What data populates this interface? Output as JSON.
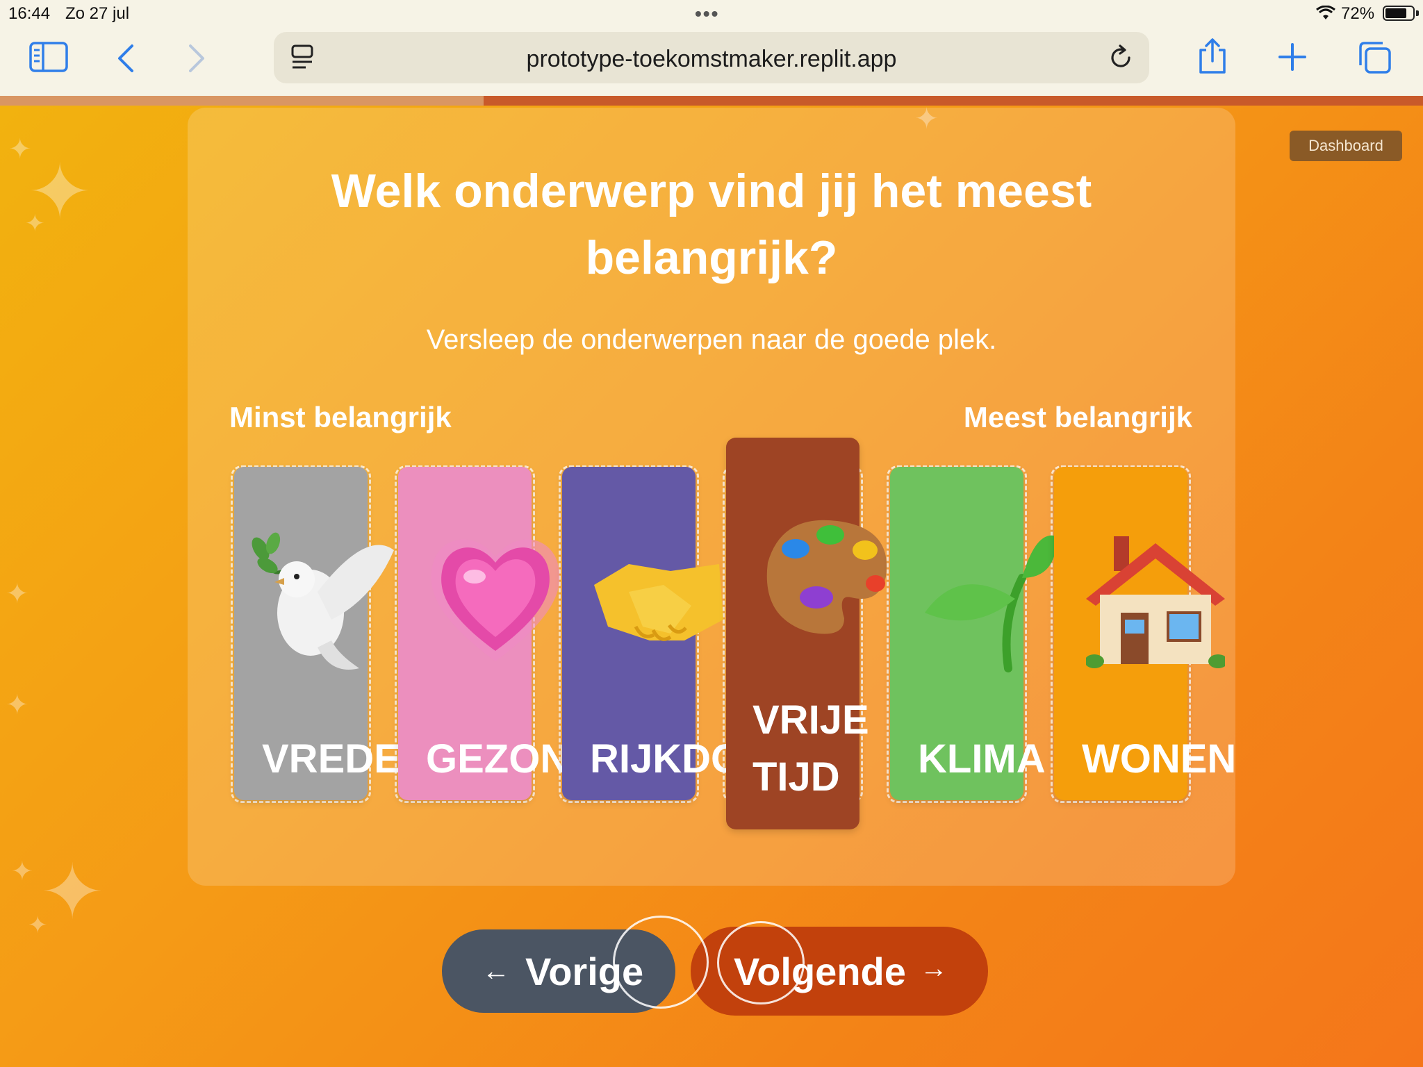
{
  "status_bar": {
    "time": "16:44",
    "date": "Zo 27 jul",
    "battery": "72%"
  },
  "browser": {
    "url": "prototype-toekomstmaker.replit.app",
    "progress": 0.34
  },
  "header": {
    "dashboard_label": "Dashboard"
  },
  "card": {
    "title": "Welk onderwerp vind jij het meest belangrijk?",
    "subtitle": "Versleep de onderwerpen naar de goede plek.",
    "label_least": "Minst belangrijk",
    "label_most": "Meest belangrijk"
  },
  "topics": [
    {
      "label": "VREDE",
      "icon": "dove-icon",
      "color": "#a3a3a3"
    },
    {
      "label": "GEZON",
      "icon": "heart-icon",
      "color": "#ec8fbe"
    },
    {
      "label": "RIJKDO",
      "icon": "handshake-icon",
      "color": "#6459a6"
    },
    {
      "label_line1": "VRIJE",
      "label_line2": "TIJD",
      "icon": "palette-icon",
      "color": "#9e4424"
    },
    {
      "label": "KLIMA",
      "icon": "seedling-icon",
      "color": "#6fc25e"
    },
    {
      "label": "WONEN",
      "icon": "house-icon",
      "color": "#f59e0b"
    }
  ],
  "nav": {
    "prev_label": "Vorige",
    "next_label": "Volgende"
  }
}
